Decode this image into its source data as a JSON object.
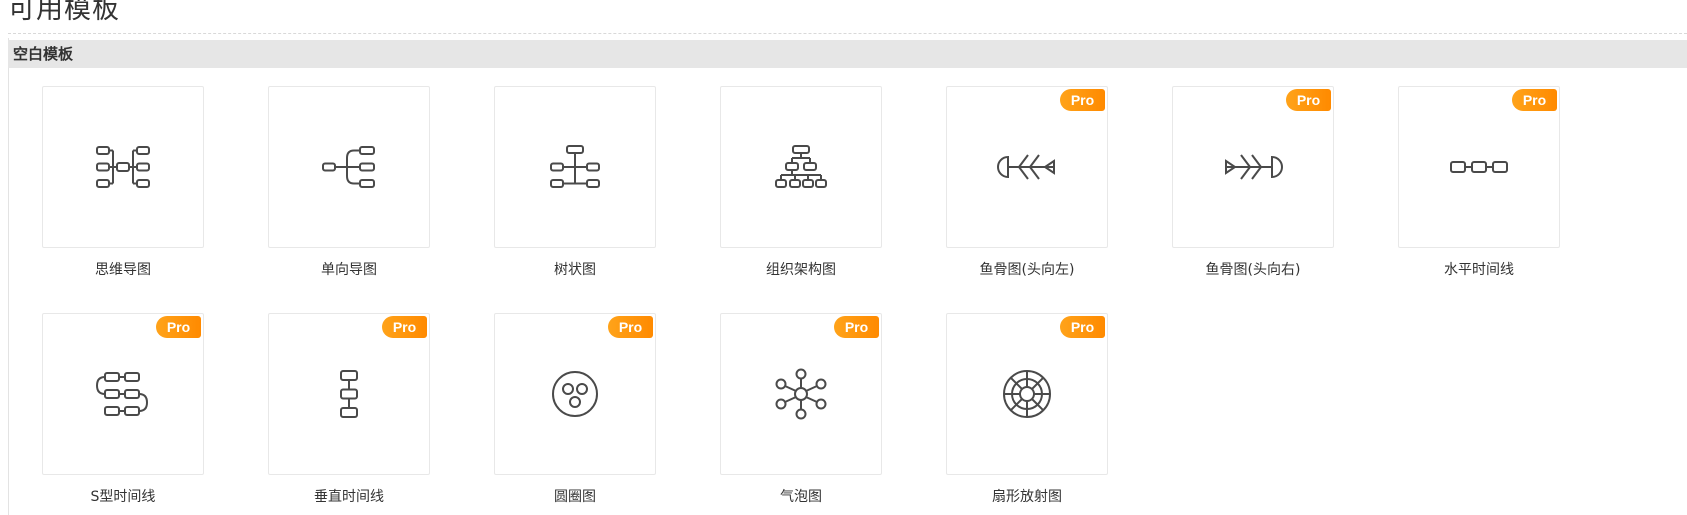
{
  "page": {
    "title": "可用模板"
  },
  "section": {
    "title": "空白模板"
  },
  "badge": {
    "pro_label": "Pro"
  },
  "templates": [
    {
      "name": "思维导图",
      "icon": "mind-map-icon",
      "pro": false
    },
    {
      "name": "单向导图",
      "icon": "one-way-map-icon",
      "pro": false
    },
    {
      "name": "树状图",
      "icon": "tree-chart-icon",
      "pro": false
    },
    {
      "name": "组织架构图",
      "icon": "org-chart-icon",
      "pro": false
    },
    {
      "name": "鱼骨图(头向左)",
      "icon": "fishbone-left-icon",
      "pro": true
    },
    {
      "name": "鱼骨图(头向右)",
      "icon": "fishbone-right-icon",
      "pro": true
    },
    {
      "name": "水平时间线",
      "icon": "horizontal-timeline-icon",
      "pro": true
    },
    {
      "name": "S型时间线",
      "icon": "s-timeline-icon",
      "pro": true
    },
    {
      "name": "垂直时间线",
      "icon": "vertical-timeline-icon",
      "pro": true
    },
    {
      "name": "圆圈图",
      "icon": "circle-chart-icon",
      "pro": true
    },
    {
      "name": "气泡图",
      "icon": "bubble-chart-icon",
      "pro": true
    },
    {
      "name": "扇形放射图",
      "icon": "sector-radial-icon",
      "pro": true
    }
  ],
  "colors": {
    "accent": "#ff9500",
    "icon_stroke": "#4a4a4a",
    "section_bg": "#e6e6e6"
  }
}
